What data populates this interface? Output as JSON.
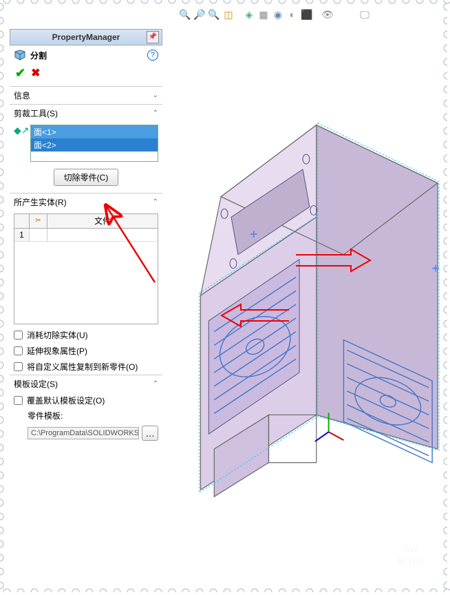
{
  "pm_title": "PropertyManager",
  "feature_name": "分割",
  "info_header": "信息",
  "trim_tools_header": "剪裁工具(S)",
  "selected_faces": [
    "面<1>",
    "面<2>"
  ],
  "cut_button": "切除零件(C)",
  "bodies_header": "所产生实体(R)",
  "file_col": "文件",
  "row_num": "1",
  "scissors": "✂",
  "consume_cb": "消耗切除实体(U)",
  "extend_cb": "延伸视象属性(P)",
  "copy_props_cb": "将自定义属性复制到新零件(O)",
  "template_header": "模板设定(S)",
  "override_cb": "覆盖默认模板设定(O)",
  "part_template_label": "零件模板:",
  "template_path": "C:\\ProgramData\\SOLIDWORKS\\",
  "watermark_top": "SW",
  "watermark_bottom": "研习社"
}
